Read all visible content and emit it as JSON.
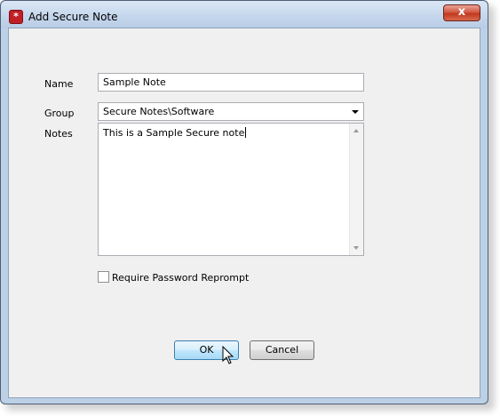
{
  "window": {
    "title": "Add Secure Note",
    "close_glyph": "x"
  },
  "form": {
    "name_label": "Name",
    "name_value": "Sample Note",
    "group_label": "Group",
    "group_value": "Secure Notes\\Software",
    "notes_label": "Notes",
    "notes_value": "This is a Sample Secure note",
    "reprompt_label": "Require Password Reprompt",
    "reprompt_checked": false
  },
  "buttons": {
    "ok_label": "OK",
    "cancel_label": "Cancel"
  },
  "icons": {
    "app_icon": "asterisk-icon",
    "close_icon": "close-icon",
    "combo_arrow": "chevron-down-icon",
    "scroll_up": "arrow-up-icon",
    "scroll_down": "arrow-down-icon",
    "cursor": "mouse-pointer-icon"
  },
  "colors": {
    "app_icon_bg": "#c01f25",
    "close_button": "#c0391f",
    "ok_border": "#3c7fb1"
  }
}
